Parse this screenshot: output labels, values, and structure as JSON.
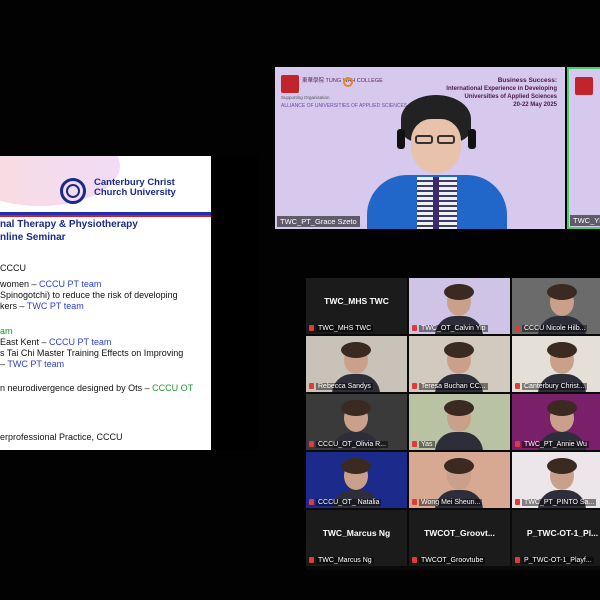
{
  "slide": {
    "logo_text": "Canterbury Christ Church University",
    "title": "nal Therapy & Physiotherapy",
    "subtitle": "nline Seminar",
    "lines": [
      {
        "text": "CCCU",
        "parts": []
      },
      {
        "text": "women – ",
        "accent": "CCCU PT team"
      },
      {
        "text": "Spinogotchi) to reduce the risk of developing",
        "accent": ""
      },
      {
        "text": "kers – ",
        "accent": "TWC PT team"
      },
      {
        "text": "",
        "accent": "am"
      },
      {
        "text": "East Kent – ",
        "accent": "CCCU PT team"
      },
      {
        "text": "s Tai Chi Master Training Effects on Improving",
        "accent": ""
      },
      {
        "text": " – ",
        "accent": "TWC PT team"
      },
      {
        "text": "n neurodivergence designed by Ots – ",
        "accent": "CCCU OT"
      },
      {
        "text": "erprofessional Practice, CCCU",
        "accent": ""
      }
    ]
  },
  "speaker": {
    "banner_college": "東華學院 TUNG WAH COLLEGE",
    "banner_partner": "Supporting Organisation",
    "banner_alliance": "ALLIANCE OF UNIVERSITIES OF APPLIED SCIENCES",
    "event_line1": "Business Success:",
    "event_line2": "International Experience in Developing",
    "event_line3": "Universities of Applied Sciences",
    "event_date": "20-22 May 2025",
    "name": "TWC_PT_Grace Szeto"
  },
  "side_tile_name": "TWC_YP",
  "gallery": [
    {
      "name": "TWC_MHS TWC",
      "big": "TWC_MHS TWC",
      "bg": "#1b1b1b",
      "video": false
    },
    {
      "name": "TWC_OT_Calvin Yip",
      "big": "",
      "bg": "#cfc3e6",
      "video": true
    },
    {
      "name": "CCCU Nicole Hilb...",
      "big": "",
      "bg": "#6b6b6b",
      "video": true
    },
    {
      "name": "Rebecca Sandys",
      "big": "",
      "bg": "#c9c2b8",
      "video": true
    },
    {
      "name": "Teresa Buchan CC...",
      "big": "",
      "bg": "#d2c9bf",
      "video": true
    },
    {
      "name": "Canterbury Christ...",
      "big": "",
      "bg": "#e4e0d8",
      "video": true
    },
    {
      "name": "CCCU_OT_Olivia R...",
      "big": "",
      "bg": "#3a3a3a",
      "video": true
    },
    {
      "name": "Yas",
      "big": "",
      "bg": "#b9c3a4",
      "video": true
    },
    {
      "name": "TWC_PT_Annie Wu",
      "big": "",
      "bg": "#7a1f6a",
      "video": true
    },
    {
      "name": "CCCU_OT_ Natalia",
      "big": "",
      "bg": "#1c2a8c",
      "video": true
    },
    {
      "name": "Wong Mei Sheun...",
      "big": "",
      "bg": "#d7a892",
      "video": true
    },
    {
      "name": "TWC_PT_PINTO Sa...",
      "big": "",
      "bg": "#ece6ea",
      "video": true
    },
    {
      "name": "TWC_Marcus Ng",
      "big": "TWC_Marcus Ng",
      "bg": "#1b1b1b",
      "video": false
    },
    {
      "name": "TWCOT_Groovtube",
      "big": "TWCOT_Groovt...",
      "bg": "#1b1b1b",
      "video": false
    },
    {
      "name": "P_TWC-OT-1_Playf...",
      "big": "P_TWC-OT-1_Pl...",
      "bg": "#1b1b1b",
      "video": false
    }
  ]
}
